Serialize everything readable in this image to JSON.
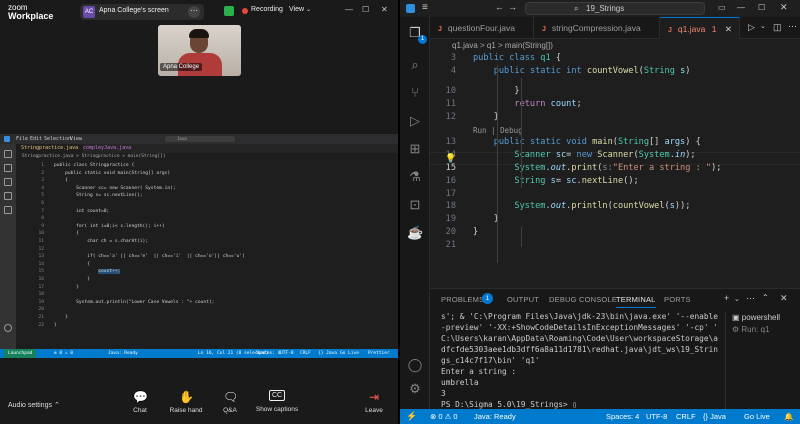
{
  "zoom": {
    "brand_top": "zoom",
    "brand_bottom": "Workplace",
    "share_avatar": "AC",
    "share_label": "Apna College's screen",
    "recording_label": "Recording",
    "view_label": "View",
    "participant_name": "Apna College",
    "audio_settings_label": "Audio settings",
    "toolbar": [
      {
        "label": "Chat",
        "icon": "chat-icon",
        "glyph": "💬"
      },
      {
        "label": "Raise hand",
        "icon": "hand-icon",
        "glyph": "✋"
      },
      {
        "label": "Q&A",
        "icon": "qa-icon",
        "glyph": "🗨"
      },
      {
        "label": "Show captions",
        "icon": "captions-icon",
        "glyph": "CC"
      }
    ],
    "leave_label": "Leave",
    "colors": {
      "recording": "#e8483b",
      "secure": "#2bb24c",
      "leave": "#ff5a4e"
    }
  },
  "shared": {
    "menu": [
      "File",
      "Edit",
      "Selection",
      "View"
    ],
    "search": "Java",
    "tabs": [
      "Stringpractice.java",
      "compleyJava.java"
    ],
    "breadcrumb": "Stringpractice.java > Stringpractice > main(String[])",
    "lines": [
      {
        "n": "1",
        "t": "public class Stringpractice {"
      },
      {
        "n": "2",
        "t": "    public static void main(String[] args)"
      },
      {
        "n": "3",
        "t": "    {"
      },
      {
        "n": "4",
        "t": "        Scanner sc= new Scanner( System.in);"
      },
      {
        "n": "5",
        "t": "        String s= sc.nextLine();"
      },
      {
        "n": "6",
        "t": ""
      },
      {
        "n": "7",
        "t": "        int count=0;"
      },
      {
        "n": "8",
        "t": ""
      },
      {
        "n": "9",
        "t": "        for( int i=0;i< s.length(); i++)"
      },
      {
        "n": "10",
        "t": "        {"
      },
      {
        "n": "11",
        "t": "            char ch = s.charAt(i);"
      },
      {
        "n": "12",
        "t": ""
      },
      {
        "n": "13",
        "t": "            if( ch=='a' || ch=='e'  || ch=='i'  || ch=='o'|| ch=='u')"
      },
      {
        "n": "14",
        "t": "            {"
      },
      {
        "n": "15",
        "t": "                count++;"
      },
      {
        "n": "16",
        "t": "            }"
      },
      {
        "n": "17",
        "t": "        }"
      },
      {
        "n": "18",
        "t": ""
      },
      {
        "n": "19",
        "t": "        System.out.println(\"Lower Case Vowels : \"+ count);"
      },
      {
        "n": "20",
        "t": ""
      },
      {
        "n": "21",
        "t": "    }"
      },
      {
        "n": "22",
        "t": "}"
      }
    ],
    "status": [
      "Launchpad",
      "⊗ 0 ⚠ 0",
      "Java: Ready",
      "Ln 16, Col 21 (8 selected)",
      "Spaces: 4",
      "UTF-8",
      "CRLF",
      "{} Java",
      "Go Live",
      "Prettier"
    ]
  },
  "vscode": {
    "title_search": "19_Strings",
    "tabs": [
      {
        "label": "questionFour.java",
        "active": false
      },
      {
        "label": "stringCompression.java",
        "active": false
      },
      {
        "label": "q1.java",
        "active": true,
        "suffix": "1"
      }
    ],
    "explorer_badge": "1",
    "breadcrumb": "q1.java > q1 > main(String[])",
    "codelens": "Run | Debug",
    "lines": [
      {
        "n": "3",
        "html": "<span class='kw'>public</span> <span class='kw'>class</span> <span class='ty'>q1</span> {"
      },
      {
        "n": "4",
        "html": "    <span class='kw'>public</span> <span class='kw'>static</span> <span class='kw'>int</span> <span class='fn'>countVowel</span>(<span class='ty'>String</span> <span class='vr'>s</span>)"
      },
      {
        "n": "10",
        "html": "        }"
      },
      {
        "n": "11",
        "html": "        <span class='cf'>return</span> <span class='vr'>count</span>;"
      },
      {
        "n": "12",
        "html": "    }"
      },
      {
        "n": "13",
        "html": "    <span class='kw'>public</span> <span class='kw'>static</span> <span class='kw'>void</span> <span class='fn'>main</span>(<span class='ty'>String</span>[] <span class='vr'>args</span>) {"
      },
      {
        "n": "14",
        "html": "        <span class='ty'>Scanner</span> <span class='vr'>sc</span>= <span class='kw'>new</span> <span class='fn'>Scanner</span>(<span class='ty'>System</span>.<span class='vr it'>in</span>);"
      },
      {
        "n": "15",
        "html": "        <span class='ty'>System</span>.<span class='vr it'>out</span>.<span class='fn'>print</span>(<span class='hint'>s:</span><span class='st'>\"Enter a string : \"</span>);"
      },
      {
        "n": "16",
        "html": "        <span class='ty'>String</span> <span class='vr'>s</span>= <span class='vr'>sc</span>.<span class='fn'>nextLine</span>();"
      },
      {
        "n": "17",
        "html": ""
      },
      {
        "n": "18",
        "html": "        <span class='ty'>System</span>.<span class='vr it'>out</span>.<span class='fn'>println</span>(<span class='fn'>countVowel</span>(<span class='vr'>s</span>));"
      },
      {
        "n": "19",
        "html": "    }"
      },
      {
        "n": "20",
        "html": "}"
      },
      {
        "n": "21",
        "html": ""
      }
    ],
    "panel": {
      "tabs": [
        "PROBLEMS",
        "OUTPUT",
        "DEBUG CONSOLE",
        "TERMINAL",
        "PORTS"
      ],
      "active_tab": "TERMINAL",
      "problems_badge": "1",
      "terminal": [
        "s'; & 'C:\\Program Files\\Java\\jdk-23\\bin\\java.exe' '--enable",
        "-preview' '-XX:+ShowCodeDetailsInExceptionMessages' '-cp' '",
        "C:\\Users\\karan\\AppData\\Roaming\\Code\\User\\workspaceStorage\\a",
        "dfcfde5303aee1db3dff6a8a11d1781\\redhat.java\\jdt_ws\\19_Strin",
        "gs_c14c7f17\\bin' 'q1'",
        "Enter a string :",
        "umbrella",
        "3",
        "PS D:\\Sigma 5.0\\19_Strings> ▯"
      ],
      "terminal_list": [
        "powershell",
        "Run: q1"
      ]
    },
    "status": {
      "errors": "⊗ 0 ⚠ 0",
      "java": "Java: Ready",
      "spaces": "Spaces: 4",
      "encoding": "UTF-8",
      "eol": "CRLF",
      "lang": "{} Java",
      "golive": "Go Live"
    },
    "colors": {
      "accent": "#007acc",
      "keyword": "#569cd6",
      "type": "#4ec9b0",
      "function": "#dcdcaa",
      "string": "#ce9178"
    }
  }
}
